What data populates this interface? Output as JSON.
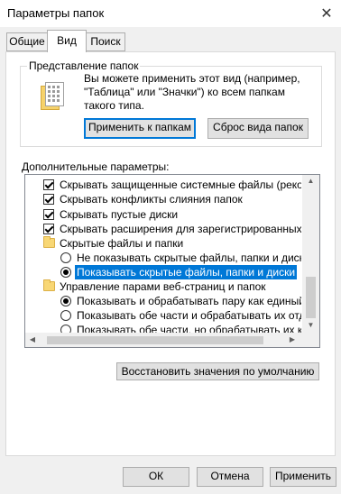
{
  "window": {
    "title": "Параметры папок",
    "close_glyph": "✕"
  },
  "tabs": [
    {
      "label": "Общие"
    },
    {
      "label": "Вид"
    },
    {
      "label": "Поиск"
    }
  ],
  "folder_views": {
    "legend": "Представление папок",
    "description_lines": [
      "Вы можете применить этот вид (например,",
      "\"Таблица\" или \"Значки\") ко всем папкам",
      "такого типа."
    ],
    "apply_button": "Применить к папкам",
    "reset_button": "Сброс вида папок"
  },
  "advanced": {
    "label": "Дополнительные параметры:",
    "items": [
      {
        "type": "checkbox",
        "label": "Скрывать защищенные системные файлы (рекомен"
      },
      {
        "type": "checkbox",
        "label": "Скрывать конфликты слияния папок"
      },
      {
        "type": "checkbox",
        "label": "Скрывать пустые диски"
      },
      {
        "type": "checkbox",
        "label": "Скрывать расширения для зарегистрированных типо"
      },
      {
        "type": "folder",
        "label": "Скрытые файлы и папки"
      },
      {
        "type": "radio",
        "label": "Не показывать скрытые файлы, папки и диски"
      },
      {
        "type": "radio",
        "label": "Показывать скрытые файлы, папки и диски"
      },
      {
        "type": "folder",
        "label": "Управление парами веб-страниц и папок"
      },
      {
        "type": "radio",
        "label": "Показывать и обрабатывать пару как единый фа"
      },
      {
        "type": "radio",
        "label": "Показывать обе части и обрабатывать их отдель"
      },
      {
        "type": "radio",
        "label": "Показывать обе части, но обрабатывать их как е"
      }
    ],
    "restore_button": "Восстановить значения по умолчанию"
  },
  "footer": {
    "ok": "ОК",
    "cancel": "Отмена",
    "apply": "Применить"
  },
  "scroll_glyphs": {
    "up": "▲",
    "down": "▼",
    "left": "◀",
    "right": "▶"
  }
}
